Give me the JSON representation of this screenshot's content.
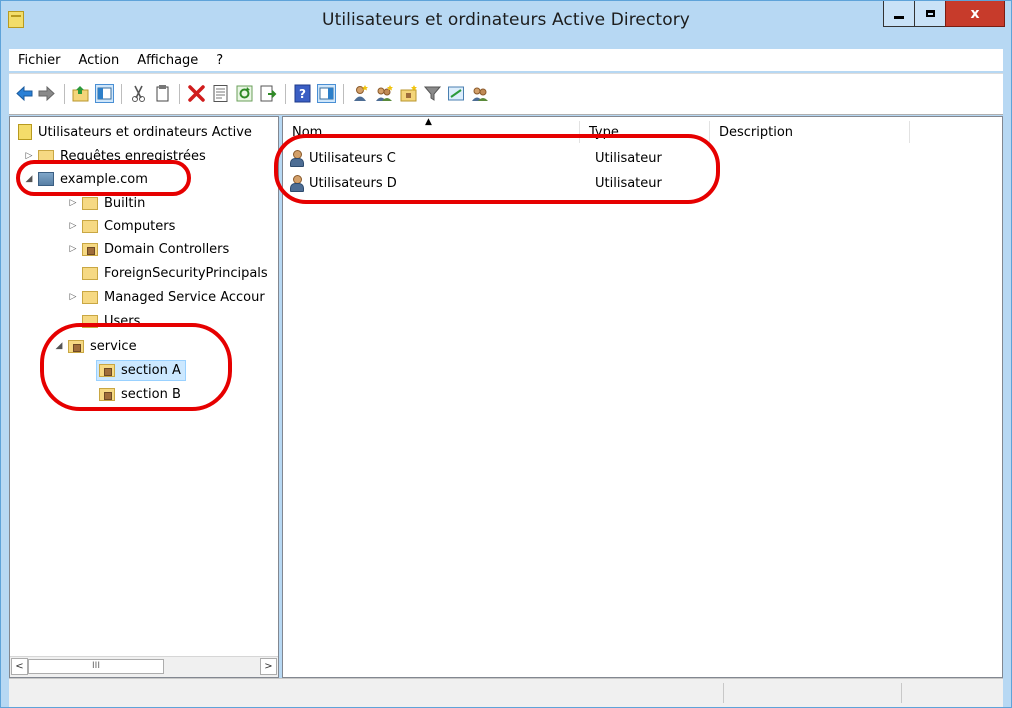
{
  "window": {
    "title": "Utilisateurs et ordinateurs Active Directory",
    "minimize_icon": "minimize-icon",
    "maximize_icon": "maximize-icon",
    "close_label": "x"
  },
  "menu": [
    "Fichier",
    "Action",
    "Affichage",
    "?"
  ],
  "toolbar": {
    "icons": [
      "back-icon",
      "forward-icon",
      "up-folder-icon",
      "show-console-tree-icon",
      "cut-icon",
      "copy-icon",
      "delete-icon",
      "properties-icon",
      "refresh-icon",
      "export-list-icon",
      "help-icon",
      "show-action-pane-icon",
      "new-user-icon",
      "new-group-icon",
      "new-ou-icon",
      "filter-icon",
      "find-icon",
      "add-to-group-icon"
    ]
  },
  "tree": {
    "root": "Utilisateurs et ordinateurs Active",
    "saved_queries": "Requêtes enregistrées",
    "domain": "example.com",
    "children": [
      "Builtin",
      "Computers",
      "Domain Controllers",
      "ForeignSecurityPrincipals",
      "Managed Service Accour",
      "Users",
      "service"
    ],
    "service_children": [
      "section A",
      "section B"
    ],
    "selected": "section A",
    "scroll_thumb_label": "III"
  },
  "list": {
    "columns": [
      "Nom",
      "Type",
      "Description"
    ],
    "rows": [
      {
        "name": "Utilisateurs C",
        "type": "Utilisateur",
        "description": ""
      },
      {
        "name": "Utilisateurs D",
        "type": "Utilisateur",
        "description": ""
      }
    ]
  },
  "annotations": {
    "color": "#e60000"
  }
}
